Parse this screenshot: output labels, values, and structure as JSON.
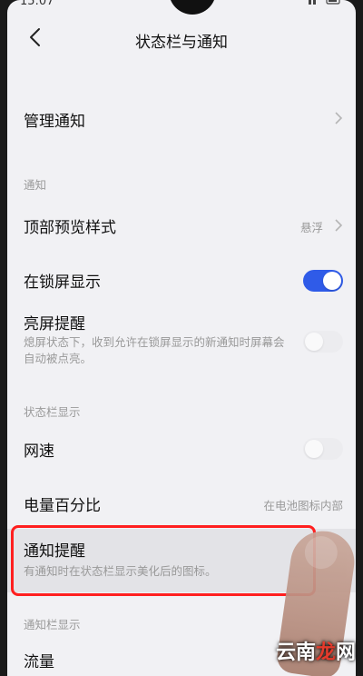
{
  "status_bar": {
    "time": "15:07"
  },
  "header": {
    "title": "状态栏与通知"
  },
  "rows": {
    "manage": {
      "label": "管理通知"
    },
    "notify_section": "通知",
    "preview": {
      "label": "顶部预览样式",
      "value": "悬浮"
    },
    "lockscreen": {
      "label": "在锁屏显示",
      "on": true
    },
    "wake": {
      "label": "亮屏提醒",
      "desc": "熄屏状态下，收到允许在锁屏显示的新通知时屏幕会自动被点亮。",
      "on": false
    },
    "statusbar_section": "状态栏显示",
    "netspeed": {
      "label": "网速",
      "on": false
    },
    "battery": {
      "label": "电量百分比",
      "value": "在电池图标内部"
    },
    "notify_remind": {
      "label": "通知提醒",
      "desc": "有通知时在状态栏显示美化后的图标。"
    },
    "notifybar_section": "通知栏显示",
    "traffic": {
      "label": "流量"
    }
  },
  "watermark": {
    "part1": "云南",
    "part2": "龙",
    "part3": "网"
  },
  "colors": {
    "toggle_on": "#2f5be8",
    "highlight_border": "#ff1f1f",
    "background": "#f1f1f4"
  }
}
